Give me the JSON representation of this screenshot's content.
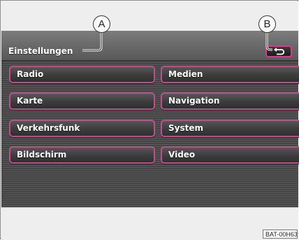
{
  "header": {
    "title": "Einstellungen",
    "back_icon": "back-arrow-icon"
  },
  "menu": {
    "buttons": [
      {
        "label": "Radio"
      },
      {
        "label": "Medien"
      },
      {
        "label": "Karte"
      },
      {
        "label": "Navigation"
      },
      {
        "label": "Verkehrsfunk"
      },
      {
        "label": "System"
      },
      {
        "label": "Bildschirm"
      },
      {
        "label": "Video"
      }
    ]
  },
  "callouts": {
    "a": "A",
    "b": "B"
  },
  "image_code": "BAT-00H63",
  "colors": {
    "button_border": "#c04d8c",
    "highlight_border": "#d53b8f",
    "header_bg": "#6b6b6b",
    "screen_bg": "#444444"
  }
}
